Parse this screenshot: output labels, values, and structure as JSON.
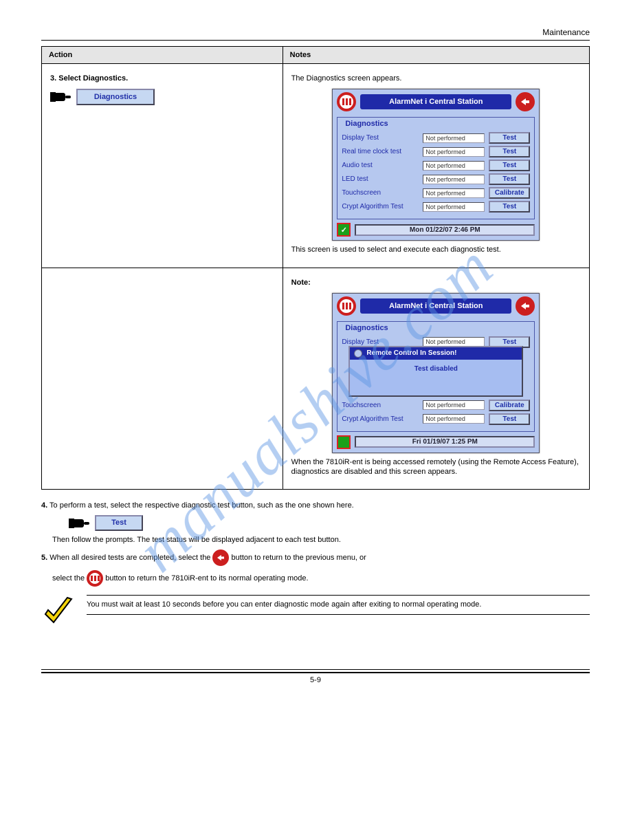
{
  "header": {
    "right": "Maintenance"
  },
  "table": {
    "col1": "Action",
    "col2": "Notes",
    "row1": {
      "step_num": "3.",
      "step_label": "Select Diagnostics.",
      "btn": "Diagnostics",
      "note1": "The Diagnostics screen appears.",
      "note2": "This screen is used to select and execute each diagnostic test.",
      "app_title": "AlarmNet i Central Station",
      "group_title": "Diagnostics",
      "rows": [
        {
          "label": "Display Test",
          "val": "Not performed",
          "btn": "Test"
        },
        {
          "label": "Real time clock test",
          "val": "Not performed",
          "btn": "Test"
        },
        {
          "label": "Audio test",
          "val": "Not performed",
          "btn": "Test"
        },
        {
          "label": "LED test",
          "val": "Not performed",
          "btn": "Test"
        },
        {
          "label": "Touchscreen",
          "val": "Not performed",
          "btn": "Calibrate"
        },
        {
          "label": "Crypt Algorithm Test",
          "val": "Not performed",
          "btn": "Test"
        }
      ],
      "date": "Mon 01/22/07  2:46 PM"
    },
    "row2": {
      "note1": "Note:",
      "note2": "When the 7810iR-ent is being accessed remotely (using the Remote Access Feature), diagnostics are disabled and this screen appears.",
      "app_title": "AlarmNet i Central Station",
      "group_title": "Diagnostics",
      "popup_title": "Remote Control In Session!",
      "popup_body": "Test disabled",
      "rows_top": [
        {
          "label": "Display Test",
          "val": "Not performed",
          "btn": "Test"
        }
      ],
      "rows_bottom": [
        {
          "label": "Touchscreen",
          "val": "Not performed",
          "btn": "Calibrate"
        },
        {
          "label": "Crypt Algorithm Test",
          "val": "Not performed",
          "btn": "Test"
        }
      ],
      "date": "Fri 01/19/07  1:25 PM"
    }
  },
  "post": {
    "step4_num": "4.",
    "step4_txt": "To perform a test, select the respective diagnostic test button, such as the one shown here.",
    "test_btn": "Test",
    "step4_2": "Then follow the prompts. The test status will be displayed adjacent to each test button.",
    "step5_num": "5.",
    "step5_1": "When all desired tests are completed, select the ",
    "step5_2": " button to return to the previous menu, or",
    "step5_3": "select the ",
    "step5_4": " button to return the 7810iR-ent to its normal operating mode.",
    "note": "You must wait at least 10 seconds before you can enter diagnostic mode again after exiting to normal operating mode."
  },
  "footer": {
    "pg": "5-9"
  },
  "watermark": "manualshive.com"
}
